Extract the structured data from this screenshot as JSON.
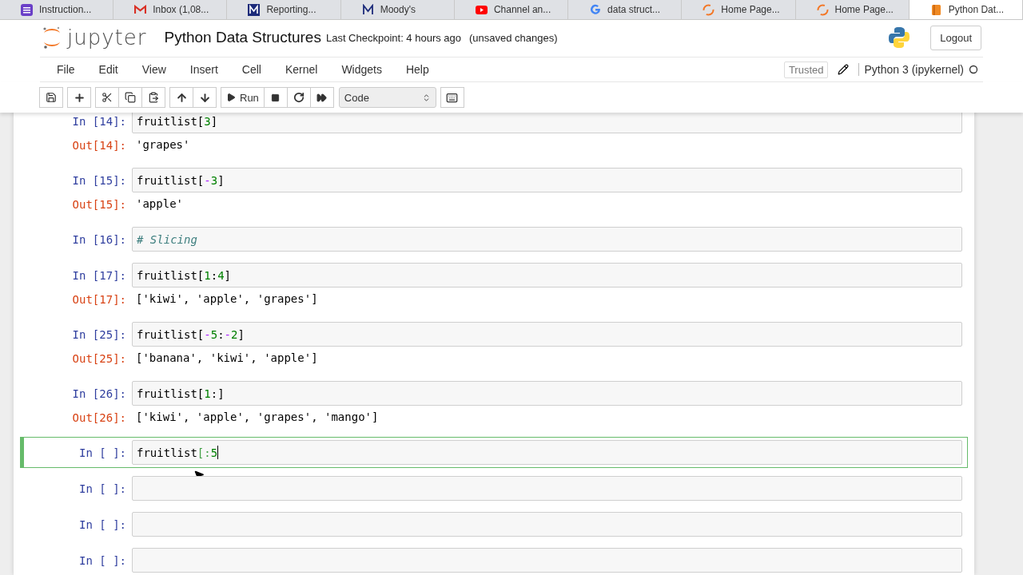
{
  "browser_tabs": [
    {
      "kind": "list",
      "title": "Instruction...",
      "selected": false
    },
    {
      "kind": "gmail",
      "title": "Inbox (1,08...",
      "selected": false
    },
    {
      "kind": "serif-m",
      "title": "Reporting...",
      "selected": false
    },
    {
      "kind": "serif-m-light",
      "title": "Moody's",
      "selected": false
    },
    {
      "kind": "youtube",
      "title": "Channel an...",
      "selected": false
    },
    {
      "kind": "google",
      "title": "data struct...",
      "selected": false
    },
    {
      "kind": "ring",
      "title": "Home Page...",
      "selected": false
    },
    {
      "kind": "ring",
      "title": "Home Page...",
      "selected": false
    },
    {
      "kind": "notebook",
      "title": "Python Dat...",
      "selected": true
    }
  ],
  "header": {
    "logo_text": "jupyter",
    "notebook_name": "Python Data Structures",
    "checkpoint": "Last Checkpoint: 4 hours ago",
    "autosave": "(unsaved changes)",
    "logout": "Logout"
  },
  "menu": [
    "File",
    "Edit",
    "View",
    "Insert",
    "Cell",
    "Kernel",
    "Widgets",
    "Help"
  ],
  "trusted": "Trusted",
  "kernel": "Python 3 (ipykernel)",
  "kernel_busy": false,
  "toolbar": {
    "run_label": "Run",
    "cell_type": "Code"
  },
  "cells": [
    {
      "prompt": "In [14]:",
      "selected": false,
      "code": [
        {
          "text": "fruitlist[",
          "kind": "name"
        },
        {
          "text": "3",
          "kind": "num"
        },
        {
          "text": "]",
          "kind": "name"
        }
      ],
      "out_prompt": "Out[14]:",
      "output": "'grapes'"
    },
    {
      "prompt": "In [15]:",
      "selected": false,
      "code": [
        {
          "text": "fruitlist[",
          "kind": "name"
        },
        {
          "text": "-",
          "kind": "op"
        },
        {
          "text": "3",
          "kind": "num"
        },
        {
          "text": "]",
          "kind": "name"
        }
      ],
      "out_prompt": "Out[15]:",
      "output": "'apple'"
    },
    {
      "prompt": "In [16]:",
      "selected": false,
      "code": [
        {
          "text": "# Slicing",
          "kind": "comment"
        }
      ]
    },
    {
      "prompt": "In [17]:",
      "selected": false,
      "code": [
        {
          "text": "fruitlist[",
          "kind": "name"
        },
        {
          "text": "1",
          "kind": "num"
        },
        {
          "text": ":",
          "kind": "name"
        },
        {
          "text": "4",
          "kind": "num"
        },
        {
          "text": "]",
          "kind": "name"
        }
      ],
      "out_prompt": "Out[17]:",
      "output": "['kiwi', 'apple', 'grapes']"
    },
    {
      "prompt": "In [25]:",
      "selected": false,
      "code": [
        {
          "text": "fruitlist[",
          "kind": "name"
        },
        {
          "text": "-",
          "kind": "op"
        },
        {
          "text": "5",
          "kind": "num"
        },
        {
          "text": ":",
          "kind": "name"
        },
        {
          "text": "-",
          "kind": "op"
        },
        {
          "text": "2",
          "kind": "num"
        },
        {
          "text": "]",
          "kind": "name"
        }
      ],
      "out_prompt": "Out[25]:",
      "output": "['banana', 'kiwi', 'apple']"
    },
    {
      "prompt": "In [26]:",
      "selected": false,
      "code": [
        {
          "text": "fruitlist[",
          "kind": "name"
        },
        {
          "text": "1",
          "kind": "num"
        },
        {
          "text": ":]",
          "kind": "name"
        }
      ],
      "out_prompt": "Out[26]:",
      "output": "['kiwi', 'apple', 'grapes', 'mango']"
    },
    {
      "prompt": "In [ ]:",
      "selected": true,
      "code": [
        {
          "text": "fruitlist",
          "kind": "name"
        },
        {
          "text": "[:",
          "kind": "bracket"
        },
        {
          "text": "5",
          "kind": "num"
        }
      ]
    },
    {
      "prompt": "In [ ]:",
      "selected": false
    },
    {
      "prompt": "In [ ]:",
      "selected": false
    },
    {
      "prompt": "In [ ]:",
      "selected": false
    }
  ]
}
